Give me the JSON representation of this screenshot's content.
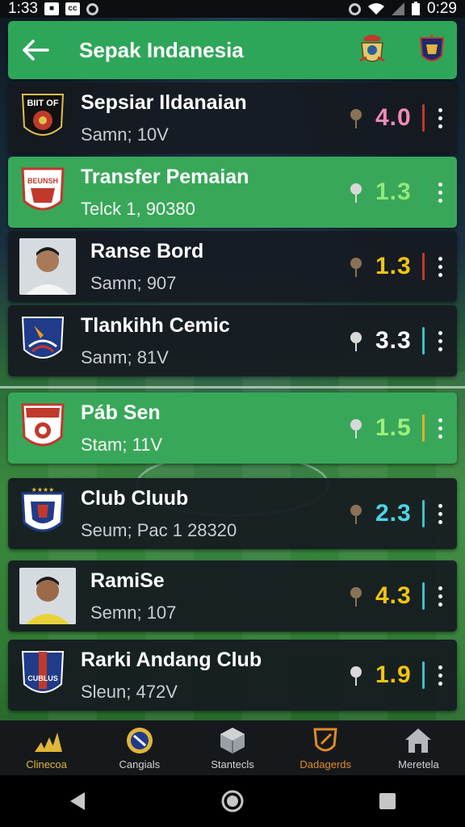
{
  "status_bar": {
    "time_left": "1:33",
    "time_right": "0:29",
    "icon_box": "cc"
  },
  "header": {
    "back_icon": "arrow-left-icon",
    "title": "Sepak Indanesia"
  },
  "rows": [
    {
      "name": "Sepsiar Ildanaian",
      "sub": "Samn; 10V",
      "score": "4.0",
      "score_color": "#f08ab8",
      "divider_color": "#c0392b",
      "bg": "dark"
    },
    {
      "name": "Transfer Pemaian",
      "sub": "Telck   1, 90380",
      "score": "1.3",
      "score_color": "#8fe87a",
      "divider_color": "#27ae60",
      "bg": "green"
    },
    {
      "name": "Ranse Bord",
      "sub": "Samn; 907",
      "score": "1.3",
      "score_color": "#f1c40f",
      "divider_color": "#c0392b",
      "bg": "dark"
    },
    {
      "name": "Tlankihh Cemic",
      "sub": "Sanm; 81V",
      "score": "3.3",
      "score_color": "#ffffff",
      "divider_color": "#3fc1c9",
      "bg": "dark"
    },
    {
      "name": "Páb Sen",
      "sub": "Stam; 11V",
      "score": "1.5",
      "score_color": "#9ef07a",
      "divider_color": "#e1b12c",
      "bg": "green"
    },
    {
      "name": "Club Cluub",
      "sub": "Seum; Pac 1 28320",
      "score": "2.3",
      "score_color": "#4fd3e8",
      "divider_color": "#3fc1c9",
      "bg": "dark"
    },
    {
      "name": "RamiSe",
      "sub": "Semn; 107",
      "score": "4.3",
      "score_color": "#f1c40f",
      "divider_color": "#3fc1c9",
      "bg": "dark"
    },
    {
      "name": "Rarki Andang Club",
      "sub": "Sleun; 472V",
      "score": "1.9",
      "score_color": "#f1c40f",
      "divider_color": "#3fc1c9",
      "bg": "dark"
    }
  ],
  "bottom_nav": [
    {
      "label": "Clinecoa",
      "icon": "stripes-icon"
    },
    {
      "label": "Cangials",
      "icon": "ball-icon"
    },
    {
      "label": "Stantecls",
      "icon": "cube-icon"
    },
    {
      "label": "Dadagerds",
      "icon": "shield-icon"
    },
    {
      "label": "Meretela",
      "icon": "home-icon"
    }
  ],
  "system_nav": [
    "back-icon",
    "home-icon",
    "recents-icon"
  ]
}
